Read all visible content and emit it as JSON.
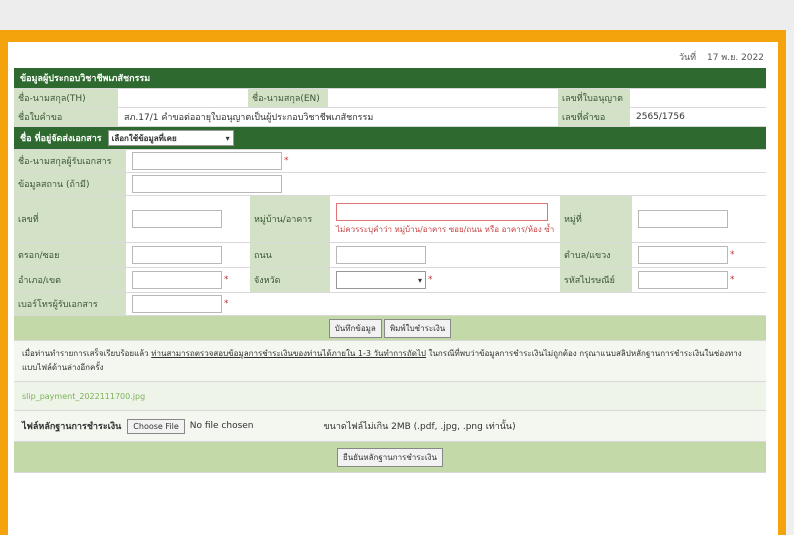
{
  "date": {
    "label": "วันที่",
    "value": "17 พ.ย. 2022"
  },
  "section1": {
    "title": "ข้อมูลผู้ประกอบวิชาชีพเภสัชกรรม",
    "rows": [
      {
        "l1": "ชื่อ-นามสกุล(TH)",
        "v1": "",
        "l2": "ชื่อ-นามสกุล(EN)",
        "v2": "",
        "l3": "เลขที่ใบอนุญาต",
        "v3": ""
      },
      {
        "l1": "ชื่อใบคำขอ",
        "v1": "สภ.17/1 คำขอต่ออายุใบอนุญาตเป็นผู้ประกอบวิชาชีพเภสัชกรรม",
        "l2": "",
        "v2": "",
        "l3": "เลขที่คำขอ",
        "v3": "2565/1756"
      }
    ]
  },
  "section2": {
    "title": "ชื่อ ที่อยู่จัดส่งเอกสาร",
    "select": "เลือกใช้ข้อมูลที่เคย",
    "recipient_label": "ชื่อ-นามสกุลผู้รับเอกสาร",
    "phone_label": "ข้อมูลสถาน (ถ้ามี)",
    "house_label": "เลขที่",
    "village_label": "หมู่บ้าน/อาคาร",
    "moo_label": "หมู่ที่",
    "village_hint": "ไม่ควรระบุคำว่า หมู่บ้าน/อาคาร ซอย/ถนน หรือ อาคาร/ห้อง ซ้ำ",
    "soi_label": "ตรอก/ซอย",
    "road_label": "ถนน",
    "subdistrict_label": "ตำบล/แขวง",
    "district_label": "อำเภอ/เขต",
    "province_label": "จังหวัด",
    "postcode_label": "รหัสไปรษณีย์",
    "mobile_label": "เบอร์โทรผู้รับเอกสาร"
  },
  "buttons": {
    "save": "บันทึกข้อมูล",
    "pay": "พิมพ์ใบชำระเงิน"
  },
  "note": {
    "text1": "เมื่อท่านทำรายการเสร็จเรียบร้อยแล้ว",
    "link": "ท่านสามารถตรวจสอบข้อมูลการชำระเงินของท่านได้ภายใน 1-3 วันทำการถัดไป",
    "text2": " ในกรณีที่พบว่าข้อมูลการชำระเงินไม่ถูกต้อง กรุณาแนบสลิปหลักฐานการชำระเงินในช่องทาง แบบไฟล์ด้านล่างอีกครั้ง"
  },
  "file_link": "slip_payment_2022111700.jpg",
  "upload": {
    "label": "ไฟล์หลักฐานการชำระเงิน",
    "button": "Choose File",
    "nofile": "No file chosen",
    "hint": "ขนาดไฟล์ไม่เกิน 2MB (.pdf, .jpg, .png เท่านั้น)"
  },
  "confirm": "ยืนยันหลักฐานการชำระเงิน"
}
